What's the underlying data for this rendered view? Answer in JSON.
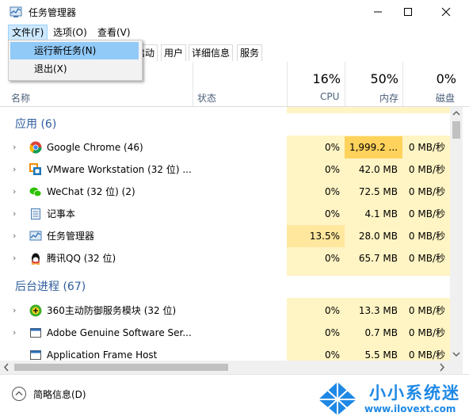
{
  "window": {
    "title": "任务管理器"
  },
  "menubar": {
    "file": "文件(F)",
    "options": "选项(O)",
    "view": "查看(V)"
  },
  "file_menu": {
    "items": [
      "运行新任务(N)",
      "退出(X)"
    ]
  },
  "tabs": [
    "启动",
    "用户",
    "详细信息",
    "服务"
  ],
  "columns": {
    "name": "名称",
    "status": "状态",
    "cpu_pct": "16%",
    "cpu": "CPU",
    "mem_pct": "50%",
    "mem": "内存",
    "disk_pct": "0%",
    "disk": "磁盘"
  },
  "groups": {
    "apps": "应用 (6)",
    "background": "后台进程 (67)"
  },
  "apps": [
    {
      "name": "Google Chrome (46)",
      "cpu": "0%",
      "mem": "1,999.2 ...",
      "disk": "0 MB/秒",
      "icon": "chrome-icon"
    },
    {
      "name": "VMware Workstation (32 位) ...",
      "cpu": "0%",
      "mem": "42.0 MB",
      "disk": "0 MB/秒",
      "icon": "vmware-icon"
    },
    {
      "name": "WeChat (32 位) (2)",
      "cpu": "0%",
      "mem": "72.5 MB",
      "disk": "0 MB/秒",
      "icon": "wechat-icon"
    },
    {
      "name": "记事本",
      "cpu": "0%",
      "mem": "4.1 MB",
      "disk": "0 MB/秒",
      "icon": "notepad-icon"
    },
    {
      "name": "任务管理器",
      "cpu": "13.5%",
      "mem": "28.0 MB",
      "disk": "0 MB/秒",
      "icon": "taskmgr-icon"
    },
    {
      "name": "腾讯QQ (32 位)",
      "cpu": "0%",
      "mem": "65.7 MB",
      "disk": "0 MB/秒",
      "icon": "qq-icon"
    }
  ],
  "background": [
    {
      "name": "360主动防御服务模块 (32 位)",
      "cpu": "0%",
      "mem": "13.3 MB",
      "disk": "0 MB/秒",
      "icon": "360-icon"
    },
    {
      "name": "Adobe Genuine Software Ser...",
      "cpu": "0%",
      "mem": "0.7 MB",
      "disk": "0 MB/秒",
      "icon": "service-icon"
    },
    {
      "name": "Application Frame Host",
      "cpu": "0%",
      "mem": "5.5 MB",
      "disk": "0 MB/秒",
      "icon": "service-icon"
    }
  ],
  "footer": {
    "fewer_details": "简略信息(D)"
  },
  "watermark": {
    "name": "小小系统迷",
    "url": "www.ilovext.com"
  },
  "colors": {
    "heat": "#fff4c4",
    "heat_high": "#ffe79e",
    "group": "#2f5d9b",
    "menu_highlight": "#91c9f7"
  }
}
